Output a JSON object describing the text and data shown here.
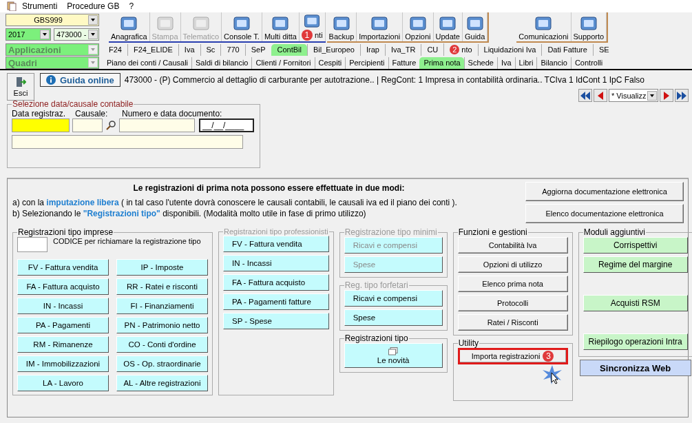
{
  "menu": [
    "Strumenti",
    "Procedure GB",
    "?"
  ],
  "company_combo": {
    "value": "GBS999"
  },
  "year_combo": {
    "value": "2017"
  },
  "activity_combo": {
    "value": "473000 -"
  },
  "applicazioni_combo": {
    "value": "Applicazioni"
  },
  "quadri_combo": {
    "value": "Quadri"
  },
  "toolbar_groups": [
    {
      "kind": "main",
      "buttons": [
        {
          "label": "Anagrafica",
          "disabled": false
        },
        {
          "label": "Stampa",
          "disabled": true
        },
        {
          "label": "Telematico",
          "disabled": true
        },
        {
          "label": "Console T.",
          "disabled": false
        },
        {
          "label": "Multi ditta",
          "disabled": false
        },
        {
          "label": "nti",
          "disabled": false,
          "callout": "1"
        }
      ]
    },
    {
      "kind": "tools",
      "buttons": [
        {
          "label": "Backup",
          "disabled": false
        },
        {
          "label": "Importazioni",
          "disabled": false
        },
        {
          "label": "Opzioni",
          "disabled": false
        },
        {
          "label": "Update",
          "disabled": false
        },
        {
          "label": "Guida",
          "disabled": false
        }
      ]
    },
    {
      "kind": "support",
      "buttons": [
        {
          "label": "Comunicazioni",
          "disabled": false
        },
        {
          "label": "Supporto",
          "disabled": false
        }
      ]
    }
  ],
  "app_tabs": [
    {
      "label": "F24",
      "selected": false
    },
    {
      "label": "F24_ELIDE",
      "selected": false
    },
    {
      "label": "Iva",
      "selected": false
    },
    {
      "label": "Sc",
      "selected": false
    },
    {
      "label": "770",
      "selected": false
    },
    {
      "label": "SeP",
      "selected": false
    },
    {
      "label": "ContBil",
      "selected": true
    },
    {
      "label": "Bil_Europeo",
      "selected": false
    },
    {
      "label": "Irap",
      "selected": false
    },
    {
      "label": "Iva_TR",
      "selected": false
    },
    {
      "label": "CU",
      "selected": false
    },
    {
      "label": "nto",
      "selected": false,
      "callout": "2"
    },
    {
      "label": "Liquidazioni Iva",
      "selected": false
    },
    {
      "label": "Dati Fatture",
      "selected": false
    },
    {
      "label": "SE",
      "selected": false
    }
  ],
  "section_tabs": [
    {
      "label": "Piano dei conti / Causali",
      "selected": false
    },
    {
      "label": "Saldi di bilancio",
      "selected": false
    },
    {
      "label": "Clienti / Fornitori",
      "selected": false
    },
    {
      "label": "Cespiti",
      "selected": false
    },
    {
      "label": "Percipienti",
      "selected": false
    },
    {
      "label": "Fatture",
      "selected": false
    },
    {
      "label": "Prima nota",
      "selected": true
    },
    {
      "label": "Schede",
      "selected": false
    },
    {
      "label": "Iva",
      "selected": false
    },
    {
      "label": "Libri",
      "selected": false
    },
    {
      "label": "Bilancio",
      "selected": false
    },
    {
      "label": "Controlli",
      "selected": false
    }
  ],
  "exit_button": "Esci",
  "help_button": "Guida online",
  "info": "473000 - (P) Commercio al dettaglio di carburante per autotrazione.. | RegCont: 1 Impresa  in contabilità ordinaria..  TCIva 1 IdCont 1 IpC Falso",
  "record_nav": {
    "filter": "* Visualizz"
  },
  "date_selection": {
    "title": "Selezione data/causale contabile",
    "date_label": "Data registraz.",
    "causal_label": "Causale:",
    "doc_label": "Numero e data documento:",
    "doc_date": "__/__/____"
  },
  "intro": {
    "heading": "Le registrazioni di prima nota possono essere effettuate in due modi:",
    "lines": [
      "a) con la  **imputazione libera**  ( in tal caso l'utente dovrà conoscere le causali contabili, le causali iva ed il piano dei conti ).",
      "b) Selezionando le  **\"Registrazioni tipo\"**  disponibili. (Modalità molto utile in fase di primo utilizzo)"
    ]
  },
  "doc_buttons": [
    "Aggiorna documentazione elettronica",
    "Elenco documentazione elettronica"
  ],
  "imprese": {
    "title": "Registrazioni tipo imprese",
    "code_hint": "CODICE per richiamare la registrazione tipo",
    "buttons": [
      "FV - Fattura vendita",
      "IP - Imposte",
      "FA - Fattura acquisto",
      "RR - Ratei e risconti",
      "IN - Incassi",
      "FI - Finanziamenti",
      "PA - Pagamenti",
      "PN - Patrimonio netto",
      "RM - Rimanenze",
      "CO - Conti d'ordine",
      "IM - Immobilizzazioni",
      "OS - Op. straordinarie",
      "LA - Lavoro",
      "AL - Altre registrazioni"
    ]
  },
  "professionisti": {
    "title": "Registrazioni tipo professionisti",
    "disabled": true,
    "buttons": [
      {
        "label": "FV - Fattura vendita",
        "disabled": false
      },
      {
        "label": "IN - Incassi",
        "disabled": false
      },
      {
        "label": "FA - Fattura acquisto",
        "disabled": false
      },
      {
        "label": "PA - Pagamenti fatture",
        "disabled": false
      },
      {
        "label": "SP - Spese",
        "disabled": false
      }
    ]
  },
  "minimi": {
    "title": "Registrazione tipo minimi",
    "disabled": true,
    "buttons": [
      {
        "label": "Ricavi e compensi",
        "disabled": true
      },
      {
        "label": "Spese",
        "disabled": true
      }
    ]
  },
  "forfetari": {
    "title": "Reg. tipo forfetari",
    "disabled": true,
    "buttons": [
      {
        "label": "Ricavi e compensi",
        "disabled": false
      },
      {
        "label": "Spese",
        "disabled": false
      }
    ]
  },
  "registrazioni_tipo": {
    "title": "Registrazioni tipo",
    "button": "Le novità"
  },
  "funzioni": {
    "title": "Funzioni e gestioni",
    "buttons": [
      "Contabilità Iva",
      "Opzioni di utilizzo",
      "Elenco prima nota",
      "Protocolli",
      "Ratei / Risconti"
    ]
  },
  "utility": {
    "title": "Utility",
    "buttons": [
      {
        "label": "Importa registrazioni",
        "highlighted": true,
        "callout": "3"
      }
    ]
  },
  "moduli": {
    "title": "Moduli aggiuntivi",
    "buttons": [
      "Corrispettivi",
      "Regime del margine",
      "Acquisti RSM",
      "Riepilogo operazioni Intra"
    ]
  },
  "sync_button": "Sincronizza Web"
}
